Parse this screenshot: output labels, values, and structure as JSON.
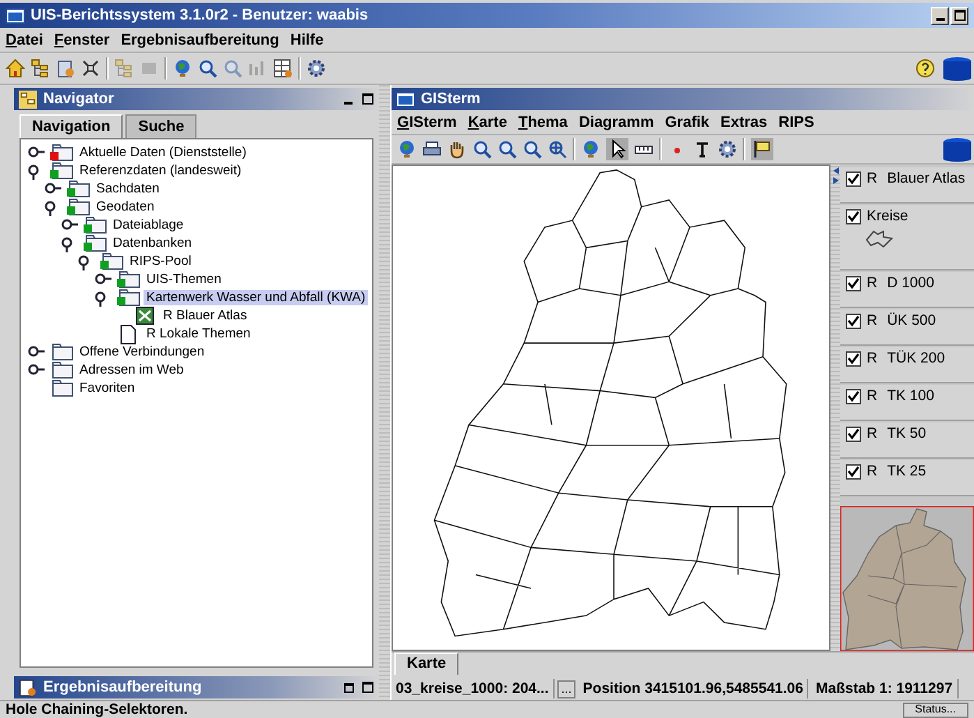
{
  "window": {
    "title": "UIS-Berichtssystem 3.1.0r2 - Benutzer: waabis"
  },
  "menu": [
    {
      "label": "Datei",
      "underlined": true
    },
    {
      "label": "Fenster",
      "underlined": true
    },
    {
      "label": "Ergebnisaufbereitung",
      "underlined": false
    },
    {
      "label": "Hilfe",
      "underlined": false
    }
  ],
  "navigator": {
    "title": "Navigator",
    "tabs": [
      {
        "label": "Navigation",
        "selected": true
      },
      {
        "label": "Suche",
        "selected": false
      }
    ],
    "tree": [
      {
        "label": "Aktuelle Daten (Dienststelle)",
        "kind": "folder",
        "color": "#e01010",
        "expanded": false,
        "selected": false
      },
      {
        "label": "Referenzdaten (landesweit)",
        "kind": "folder",
        "color": "#10a020",
        "expanded": true,
        "selected": false,
        "children": [
          {
            "label": "Sachdaten",
            "kind": "folder",
            "color": "#10a020",
            "expanded": false,
            "selected": false
          },
          {
            "label": "Geodaten",
            "kind": "folder",
            "color": "#10a020",
            "expanded": true,
            "selected": false,
            "children": [
              {
                "label": "Dateiablage",
                "kind": "folder",
                "color": "#10a020",
                "expanded": false,
                "selected": false
              },
              {
                "label": "Datenbanken",
                "kind": "folder",
                "color": "#10a020",
                "expanded": true,
                "selected": false,
                "children": [
                  {
                    "label": "RIPS-Pool",
                    "kind": "folder",
                    "color": "#10a020",
                    "expanded": true,
                    "selected": false,
                    "children": [
                      {
                        "label": "UIS-Themen",
                        "kind": "folder",
                        "color": "#10a020",
                        "expanded": false,
                        "selected": false
                      },
                      {
                        "label": "Kartenwerk Wasser und Abfall (KWA)",
                        "kind": "folder",
                        "color": "#10a020",
                        "expanded": true,
                        "selected": true,
                        "children": [
                          {
                            "label": "R  Blauer Atlas",
                            "kind": "map",
                            "selected": false
                          }
                        ]
                      },
                      {
                        "label": "R  Lokale Themen",
                        "kind": "document",
                        "selected": false
                      }
                    ]
                  }
                ]
              }
            ]
          }
        ]
      },
      {
        "label": "Offene Verbindungen",
        "kind": "folder",
        "expanded": false,
        "selected": false
      },
      {
        "label": "Adressen im Web",
        "kind": "folder",
        "expanded": false,
        "selected": false
      },
      {
        "label": "Favoriten",
        "kind": "folder",
        "selected": false
      }
    ]
  },
  "gisterm": {
    "title": "GISterm",
    "menu": [
      {
        "label": "GISterm",
        "underlined": true
      },
      {
        "label": "Karte",
        "underlined": true
      },
      {
        "label": "Thema",
        "underlined": true
      },
      {
        "label": "Diagramm",
        "underlined": false
      },
      {
        "label": "Grafik",
        "underlined": false
      },
      {
        "label": "Extras",
        "underlined": false
      },
      {
        "label": "RIPS",
        "underlined": false
      }
    ],
    "layers": [
      {
        "prefix": "R",
        "name": "Blauer Atlas",
        "checked": true,
        "kind": "plain"
      },
      {
        "name": "Kreise",
        "checked": true,
        "kind": "legend"
      },
      {
        "prefix": "R",
        "name": "D 1000",
        "checked": true,
        "kind": "plain"
      },
      {
        "prefix": "R",
        "name": "ÜK 500",
        "checked": true,
        "kind": "plain"
      },
      {
        "prefix": "R",
        "name": "TÜK 200",
        "checked": true,
        "kind": "plain"
      },
      {
        "prefix": "R",
        "name": "TK 100",
        "checked": true,
        "kind": "plain"
      },
      {
        "prefix": "R",
        "name": "TK 50",
        "checked": true,
        "kind": "plain"
      },
      {
        "prefix": "R",
        "name": "TK 25",
        "checked": true,
        "kind": "plain"
      }
    ],
    "tabs": [
      {
        "label": "Karte",
        "selected": true
      }
    ],
    "status": {
      "layer": "03_kreise_1000: 204...",
      "button": "...",
      "position": "Position 3415101.96,5485541.06",
      "scale": "Maßstab 1: 1911297"
    }
  },
  "result_panel": {
    "title": "Ergebnisaufbereitung"
  },
  "status_bar": {
    "message": "Hole Chaining-Selektoren.",
    "button": "Status..."
  }
}
